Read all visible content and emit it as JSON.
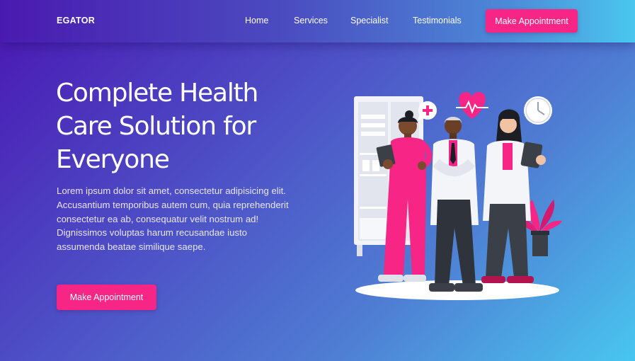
{
  "nav": {
    "brand": "EGATOR",
    "links": [
      "Home",
      "Services",
      "Specialist",
      "Testimonials"
    ],
    "cta": "Make Appointment"
  },
  "hero": {
    "title": "Complete Health Care Solution for Everyone",
    "body": "Lorem ipsum dolor sit amet, consectetur adipisicing elit. Accusantium temporibus autem cum, quia reprehenderit consectetur ea ab, consequatur velit nostrum ad! Dignissimos voluptas harum recusandae iusto assumenda beatae similique saepe.",
    "cta": "Make Appointment"
  },
  "colors": {
    "accent": "#f72585",
    "gradient_start": "#4a16b3",
    "gradient_end": "#48c6ef"
  },
  "illustration": {
    "icons": [
      "medical-cabinet-icon",
      "speech-bubble-plus-icon",
      "heart-pulse-icon",
      "clock-icon",
      "potted-plant-icon"
    ],
    "figures": [
      "doctor-pink-scrubs",
      "doctor-lab-coat-male",
      "doctor-lab-coat-female"
    ]
  }
}
